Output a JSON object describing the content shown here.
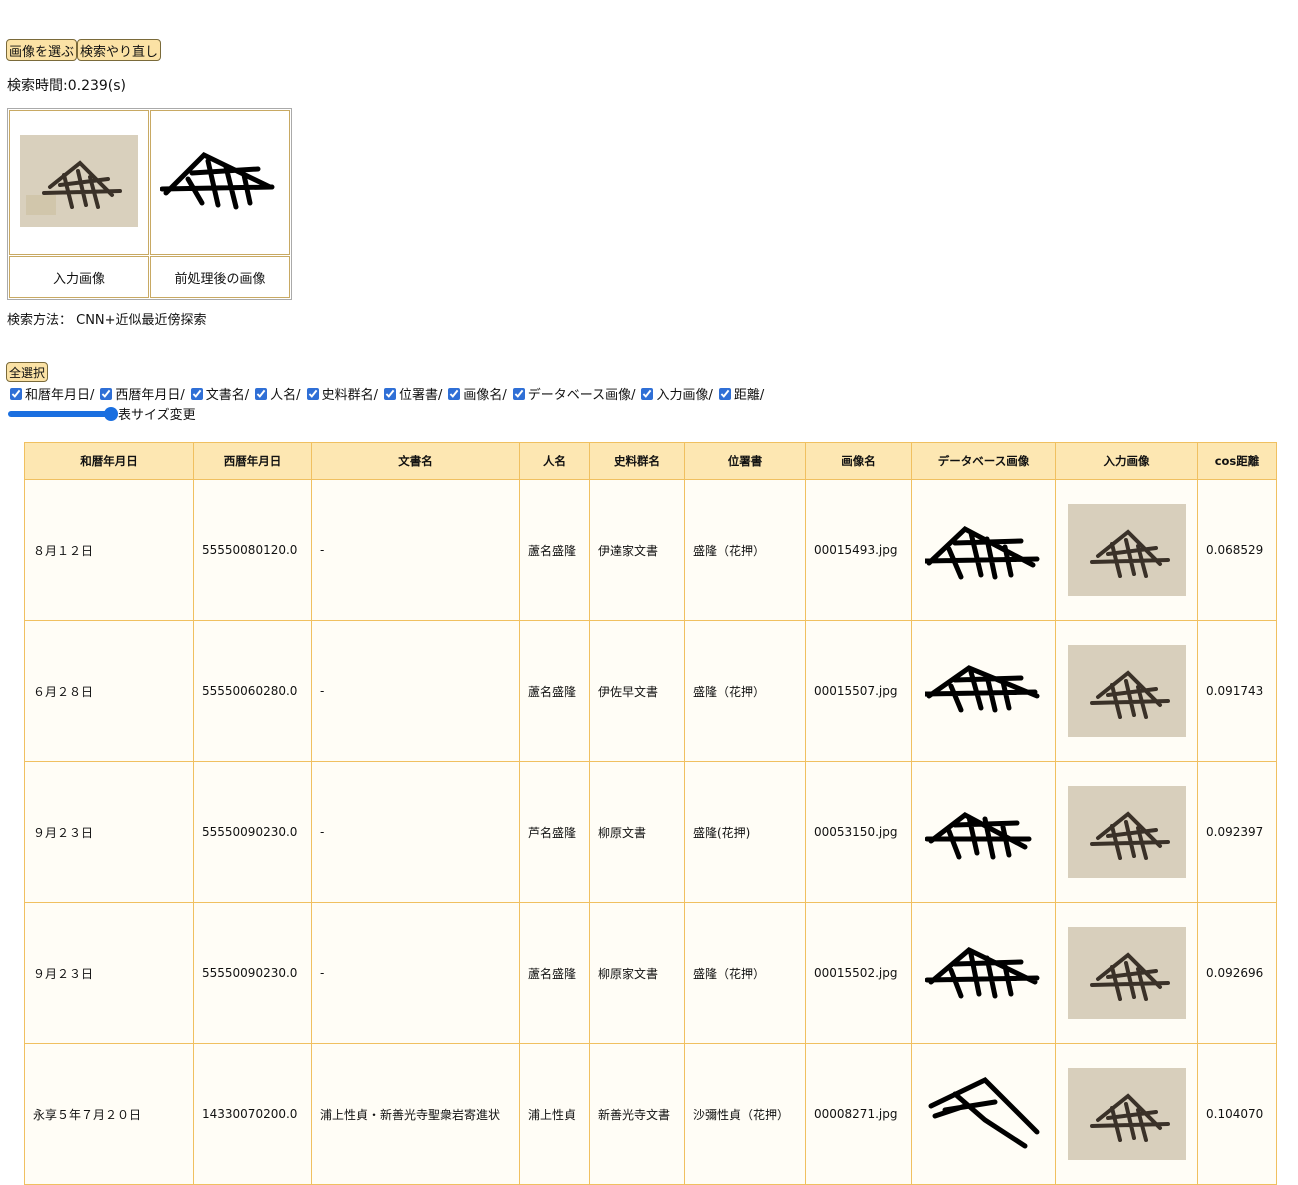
{
  "toolbar": {
    "choose_label": "画像を選ぶ",
    "redo_label": "検索やり直し"
  },
  "search_time": "検索時間:0.239(s)",
  "preview": {
    "input_caption": "入力画像",
    "processed_caption": "前処理後の画像"
  },
  "method_text": "検索方法： CNN+近似最近傍探索",
  "select_all_label": "全選択",
  "columns_toggle": [
    "和暦年月日/",
    "西暦年月日/",
    "文書名/",
    "人名/",
    "史料群名/",
    "位署書/",
    "画像名/",
    "データベース画像/",
    "入力画像/",
    "距離/"
  ],
  "size_label": "表サイズ変更",
  "table": {
    "headers": [
      "和暦年月日",
      "西暦年月日",
      "文書名",
      "人名",
      "史料群名",
      "位署書",
      "画像名",
      "データベース画像",
      "入力画像",
      "cos距離"
    ],
    "rows": [
      {
        "wareki": "８月１２日",
        "seireki": "55550080120.0",
        "doc": "-",
        "person": "蘆名盛隆",
        "collection": "伊達家文書",
        "signature": "盛隆（花押）",
        "image": "00015493.jpg",
        "distance": "0.068529"
      },
      {
        "wareki": "６月２８日",
        "seireki": "55550060280.0",
        "doc": "-",
        "person": "蘆名盛隆",
        "collection": "伊佐早文書",
        "signature": "盛隆（花押）",
        "image": "00015507.jpg",
        "distance": "0.091743"
      },
      {
        "wareki": "９月２３日",
        "seireki": "55550090230.0",
        "doc": "-",
        "person": "芦名盛隆",
        "collection": "柳原文書",
        "signature": "盛隆(花押)",
        "image": "00053150.jpg",
        "distance": "0.092397"
      },
      {
        "wareki": "９月２３日",
        "seireki": "55550090230.0",
        "doc": "-",
        "person": "蘆名盛隆",
        "collection": "柳原家文書",
        "signature": "盛隆（花押）",
        "image": "00015502.jpg",
        "distance": "0.092696"
      },
      {
        "wareki": "永享５年７月２０日",
        "seireki": "14330070200.0",
        "doc": "浦上性貞・新善光寺聖衆岩寄進状",
        "person": "浦上性貞",
        "collection": "新善光寺文書",
        "signature": "沙彌性貞（花押）",
        "image": "00008271.jpg",
        "distance": "0.104070"
      }
    ]
  }
}
